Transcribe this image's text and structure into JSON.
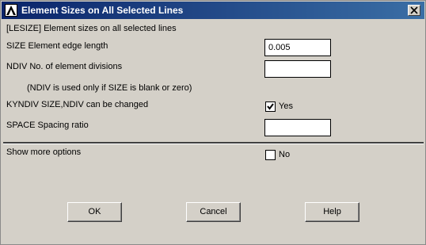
{
  "window": {
    "title": "Element Sizes on All Selected Lines"
  },
  "header": {
    "command": "[LESIZE]  Element sizes on all selected lines"
  },
  "size": {
    "label": "SIZE    Element edge length",
    "value": "0.005"
  },
  "ndiv": {
    "label": "NDIV    No. of element divisions",
    "value": ""
  },
  "note": "(NDIV is used only if SIZE is blank or zero)",
  "kyndiv": {
    "label": "KYNDIV  SIZE,NDIV can be changed",
    "checked": true,
    "value_label": "Yes"
  },
  "space": {
    "label": "SPACE   Spacing ratio",
    "value": ""
  },
  "more_options": {
    "label": "Show more options",
    "checked": false,
    "value_label": "No"
  },
  "buttons": {
    "ok": "OK",
    "cancel": "Cancel",
    "help": "Help"
  },
  "icons": {
    "app": "ansys-logo-icon",
    "close": "close-icon",
    "check": "checkmark-icon"
  },
  "colors": {
    "titlebar_start": "#0a246a",
    "titlebar_end": "#3a6ea5",
    "dialog_bg": "#d4d0c8"
  }
}
